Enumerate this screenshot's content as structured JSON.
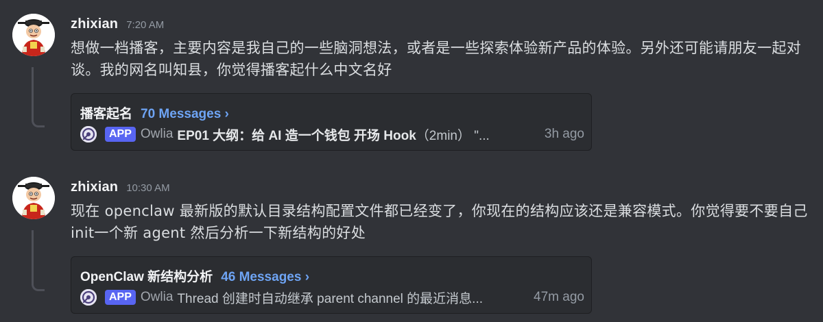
{
  "messages": [
    {
      "username": "zhixian",
      "timestamp": "7:20 AM",
      "content": "想做一档播客，主要内容是我自己的一些脑洞想法，或者是一些探索体验新产品的体验。另外还可能请朋友一起对谈。我的网名叫知县，你觉得播客起什么中文名好",
      "thread": {
        "name": "播客起名",
        "message_count": "70 Messages ›",
        "badge": "APP",
        "bot_name": "Owlia",
        "preview_bold": "EP01 大纲：给 AI 造一个钱包 开场 Hook",
        "preview_rest": "（2min） \"...",
        "time_ago": "3h ago"
      }
    },
    {
      "username": "zhixian",
      "timestamp": "10:30 AM",
      "content": "现在 openclaw 最新版的默认目录结构配置文件都已经变了，你现在的结构应该还是兼容模式。你觉得要不要自己init一个新 agent 然后分析一下新结构的好处",
      "thread": {
        "name": "OpenClaw 新结构分析",
        "message_count": "46 Messages ›",
        "badge": "APP",
        "bot_name": "Owlia",
        "preview_bold": "",
        "preview_rest": "Thread 创建时自动继承 parent channel 的最近消息...",
        "time_ago": "47m ago"
      }
    }
  ],
  "colors": {
    "background": "#313338",
    "thread_card": "#2b2d31",
    "link_blue": "#6ea4f4",
    "app_badge": "#5865f2"
  },
  "icons": {
    "user_avatar": "cartoon-official-avatar",
    "bot_avatar": "owl-avatar"
  }
}
